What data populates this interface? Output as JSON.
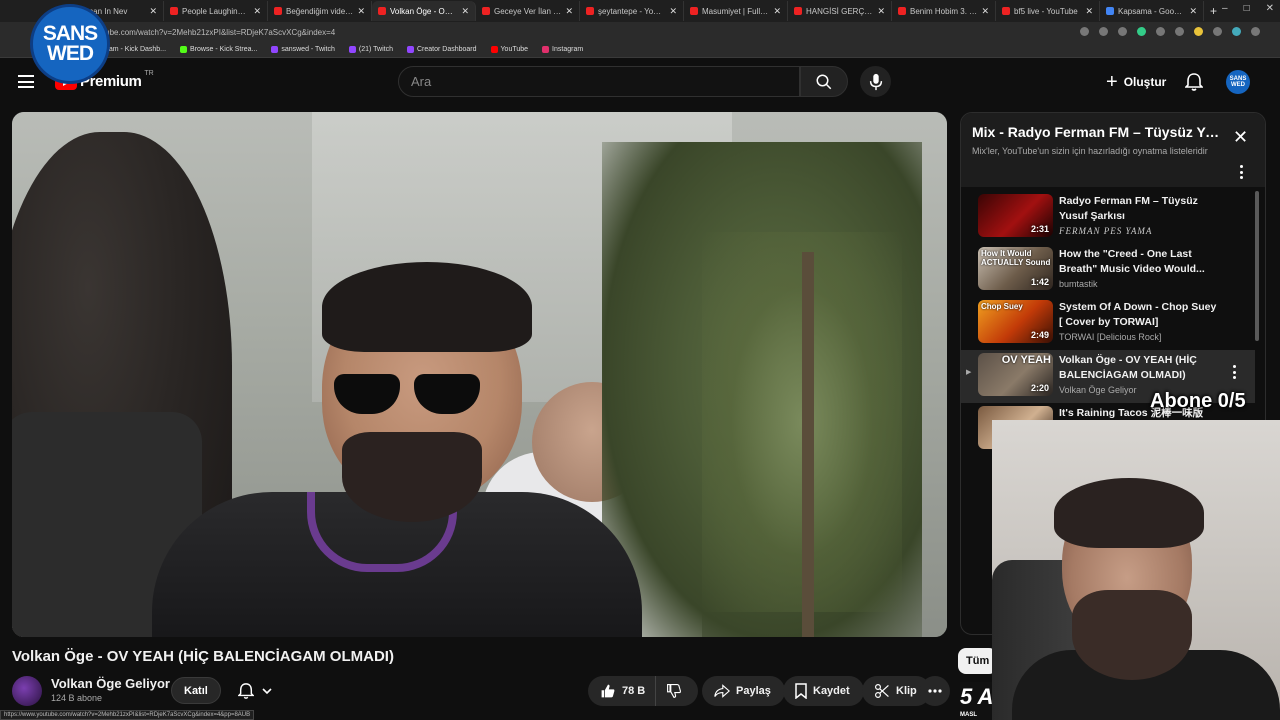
{
  "browser": {
    "tabs": [
      {
        "label": "chman In Nev",
        "favicon": "yt",
        "active": false
      },
      {
        "label": "People Laughing at Serio",
        "favicon": "yt",
        "active": false
      },
      {
        "label": "Beğendiğim videolar - Yo",
        "favicon": "yt",
        "active": false
      },
      {
        "label": "Volkan Öge - OV YEAH",
        "favicon": "yt",
        "active": true
      },
      {
        "label": "Geceye Ver İlan [2026 Yen",
        "favicon": "yt",
        "active": false
      },
      {
        "label": "şeytantepe - YouTube",
        "favicon": "yt",
        "active": false
      },
      {
        "label": "Masumiyet | Full Film | Ze",
        "favicon": "yt",
        "active": false
      },
      {
        "label": "HANGİSİ GERÇEK ESKİ SE",
        "favicon": "yt",
        "active": false
      },
      {
        "label": "Benim Hobim 3. Bölüm",
        "favicon": "yt",
        "active": false
      },
      {
        "label": "bf5 live - YouTube",
        "favicon": "yt",
        "active": false
      },
      {
        "label": "Kapsama - Google'da Ara",
        "favicon": "google",
        "active": false
      }
    ],
    "tab_close": "✕",
    "new_tab": "+",
    "window_controls": [
      "–",
      "□",
      "✕"
    ],
    "url": "youtube.com/watch?v=2Mehb21zxPI&list=RDjeK7aScvXCg&index=4",
    "bookmarks": [
      {
        "label": "Stream - Kick Dashb...",
        "icon": "kick"
      },
      {
        "label": "Browse - Kick Strea...",
        "icon": "kick"
      },
      {
        "label": "sanswed - Twitch",
        "icon": "twitch"
      },
      {
        "label": "(21) Twitch",
        "icon": "twitch"
      },
      {
        "label": "Creator Dashboard",
        "icon": "twitch"
      },
      {
        "label": "YouTube",
        "icon": "youtube"
      },
      {
        "label": "Instagram",
        "icon": "instagram"
      }
    ],
    "status_url": "https://www.youtube.com/watch?v=2Mehb21zxPI&list=RDjeK7aScvXCg&index=4&pp=8AUB"
  },
  "overlay": {
    "logo_line1": "SANS",
    "logo_line2": "WED",
    "sub_counter": "Abone 0/5"
  },
  "header": {
    "logo_text": "Premium",
    "logo_region": "TR",
    "search_placeholder": "Ara",
    "create_label": "Oluştur",
    "avatar_text": "SANS WED"
  },
  "video": {
    "title": "Volkan Öge - OV YEAH (HİÇ BALENCİAGAM OLMADI)",
    "channel": "Volkan Öge Geliyor",
    "subscribers": "124 B abone",
    "join_label": "Katıl",
    "likes": "78 B",
    "share_label": "Paylaş",
    "save_label": "Kaydet",
    "clip_label": "Klip"
  },
  "playlist": {
    "title": "Mix - Radyo Ferman FM – Tüysüz Yusuf Şarkısı",
    "subtitle": "Mix'ler, YouTube'un sizin için hazırladığı oynatma listeleridir",
    "close": "✕",
    "items": [
      {
        "title": "Radyo Ferman FM – Tüysüz Yusuf Şarkısı",
        "channel": "FERMAN PES YAMA",
        "duration": "2:31",
        "thumb_text": "",
        "active": false
      },
      {
        "title": "How the \"Creed - One Last Breath\" Music Video Would...",
        "channel": "bumtastik",
        "duration": "1:42",
        "thumb_text": "How It Would ACTUALLY Sound",
        "active": false
      },
      {
        "title": "System Of A Down - Chop Suey [ Cover by TORWAI]",
        "channel": "TORWAI [Delicious Rock]",
        "duration": "2:49",
        "thumb_text": "Chop Suey",
        "active": false
      },
      {
        "title": "Volkan Öge - OV YEAH (HİÇ BALENCİAGAM OLMADI)",
        "channel": "Volkan Öge Geliyor",
        "duration": "2:20",
        "thumb_text": "OV YEAH",
        "active": true
      },
      {
        "title": "It's Raining Tacos 泥棒一味版",
        "channel": "",
        "duration": "",
        "thumb_text": "",
        "active": false
      }
    ],
    "playing_indicator": "▶"
  },
  "below_chips": {
    "chip_label": "Tüm",
    "thumb_big": "5 A",
    "thumb_small": "MASL"
  },
  "colors": {
    "brand_red": "#ff0000",
    "background": "#0f0f0f",
    "logo_blue": "#1565c0"
  }
}
